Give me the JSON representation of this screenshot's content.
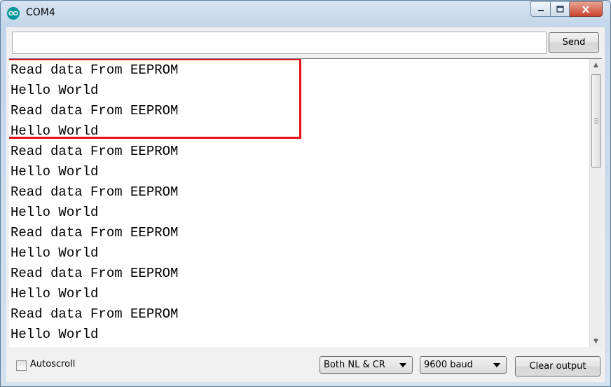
{
  "window": {
    "title": "COM4"
  },
  "toolbar": {
    "input_value": "",
    "send_label": "Send"
  },
  "output": {
    "lines": [
      "Read data From EEPROM",
      "Hello World",
      "Read data From EEPROM",
      "Hello World",
      "Read data From EEPROM",
      "Hello World",
      "Read data From EEPROM",
      "Hello World",
      "Read data From EEPROM",
      "Hello World",
      "Read data From EEPROM",
      "Hello World",
      "Read data From EEPROM",
      "Hello World"
    ],
    "highlight_color": "#e8101a"
  },
  "footer": {
    "autoscroll_label": "Autoscroll",
    "autoscroll_checked": false,
    "line_ending": "Both NL & CR",
    "baud_rate": "9600 baud",
    "clear_label": "Clear output"
  },
  "icons": {
    "app": "arduino-icon",
    "minimize": "minimize-icon",
    "maximize": "maximize-icon",
    "close": "close-icon",
    "scroll_up": "scroll-up-icon",
    "scroll_down": "scroll-down-icon"
  }
}
